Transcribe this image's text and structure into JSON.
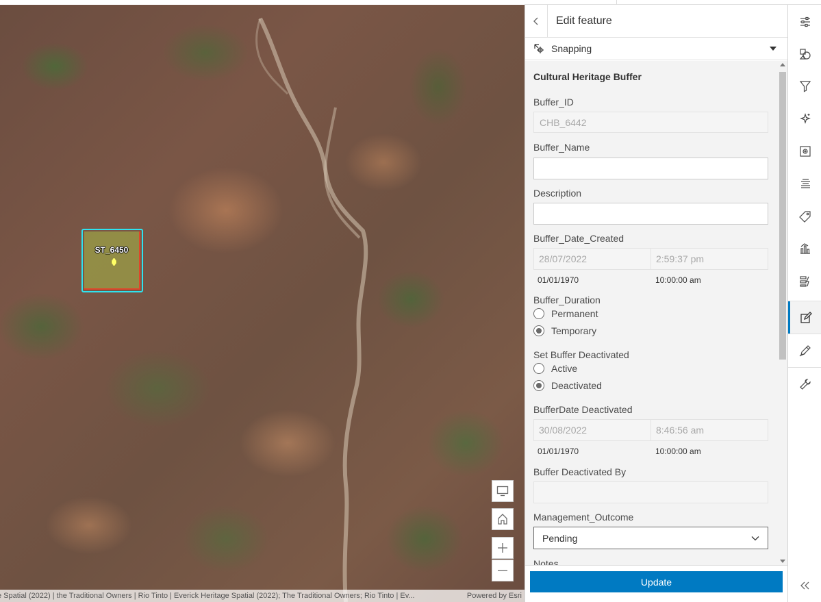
{
  "map": {
    "feature_label": "ST_6450",
    "attribution": "e Spatial (2022) | the Traditional Owners | Rio Tinto | Everick Heritage Spatial (2022); The Traditional Owners; Rio Tinto | Ev...",
    "powered_by": "Powered by Esri",
    "controls": [
      "monitor-icon",
      "home-icon",
      "plus-icon",
      "minus-icon"
    ]
  },
  "panel": {
    "title": "Edit feature",
    "snapping_label": "Snapping",
    "form_title": "Cultural Heritage Buffer",
    "fields": {
      "buffer_id": {
        "label": "Buffer_ID",
        "value": "CHB_6442"
      },
      "buffer_name": {
        "label": "Buffer_Name",
        "value": ""
      },
      "description": {
        "label": "Description",
        "value": ""
      },
      "date_created": {
        "label": "Buffer_Date_Created",
        "date": "28/07/2022",
        "time": "2:59:37 pm",
        "hint_date": "01/01/1970",
        "hint_time": "10:00:00 am"
      },
      "duration": {
        "label": "Buffer_Duration",
        "options": [
          "Permanent",
          "Temporary"
        ],
        "selected": "Temporary"
      },
      "deactivated": {
        "label": "Set Buffer Deactivated",
        "options": [
          "Active",
          "Deactivated"
        ],
        "selected": "Deactivated"
      },
      "date_deactivated": {
        "label": "BufferDate Deactivated",
        "date": "30/08/2022",
        "time": "8:46:56 am",
        "hint_date": "01/01/1970",
        "hint_time": "10:00:00 am"
      },
      "deactivated_by": {
        "label": "Buffer Deactivated By",
        "value": ""
      },
      "management_outcome": {
        "label": "Management_Outcome",
        "value": "Pending"
      },
      "notes": {
        "label": "Notes"
      }
    },
    "update_label": "Update"
  },
  "toolbar": {
    "tools": [
      "sliders-icon",
      "layer-shapes-icon",
      "filter-icon",
      "sparkle-icon",
      "gear-frame-icon",
      "list-icon",
      "tag-icon",
      "chart-icon",
      "bolt-icon",
      "edit-icon",
      "pen-measure-icon",
      "wrench-icon"
    ],
    "active": "edit-icon",
    "collapse_icon": "double-chevron-left-icon"
  },
  "colors": {
    "accent": "#007ac2",
    "highlight": "#2ee3ef",
    "feature_outline": "#e0462a"
  }
}
